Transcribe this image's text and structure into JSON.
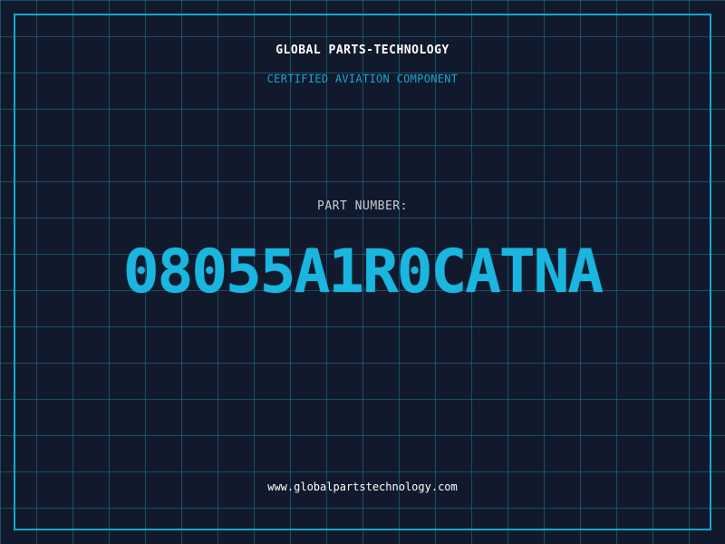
{
  "header": {
    "brand": "GLOBAL PARTS-TECHNOLOGY",
    "subtitle": "CERTIFIED AVIATION COMPONENT"
  },
  "part": {
    "label": "PART NUMBER:",
    "number": "08055A1R0CATNA"
  },
  "footer": {
    "url": "www.globalpartstechnology.com"
  },
  "colors": {
    "background": "#111a2c",
    "grid": "#1a7896",
    "accent": "#1aa6cf",
    "part_number": "#1bb6e0",
    "text_primary": "#ffffff",
    "text_muted": "#c8ccd4"
  }
}
